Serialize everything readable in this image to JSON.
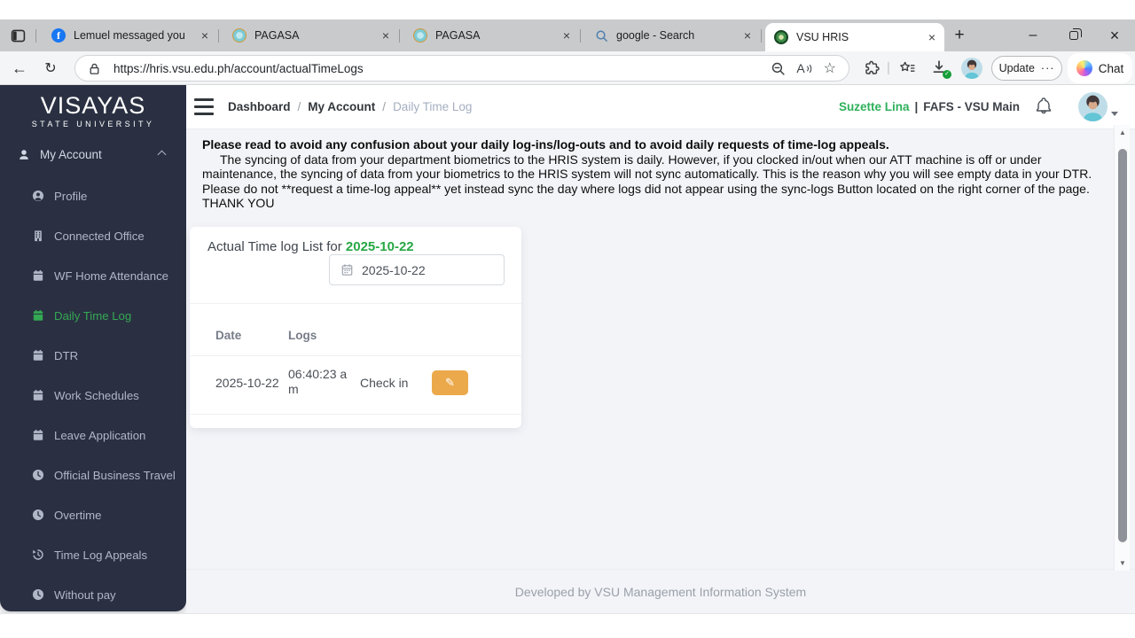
{
  "browser": {
    "tabs": [
      {
        "title": "Lemuel messaged you",
        "icon": "facebook"
      },
      {
        "title": "PAGASA",
        "icon": "pagasa"
      },
      {
        "title": "PAGASA",
        "icon": "pagasa"
      },
      {
        "title": "google - Search",
        "icon": "search"
      },
      {
        "title": "VSU HRIS",
        "icon": "vsu-seal",
        "active": true
      }
    ],
    "url": "https://hris.vsu.edu.ph/account/actualTimeLogs",
    "update_label": "Update",
    "chat_label": "Chat"
  },
  "glyphs": {
    "fb": "f",
    "tab_close": "×",
    "new_tab": "+",
    "minimize": "–",
    "window_close": "×",
    "back": "←",
    "refresh": "↻",
    "star": "☆",
    "read_aloud": "A",
    "dots": "···",
    "pipe": "|",
    "pencil": "✎",
    "scroll_up": "▲",
    "scroll_down": "▼",
    "breadcrumb_sep": "/",
    "user_sep": "|"
  },
  "sidebar": {
    "logo_line1": "VISAYAS",
    "logo_line2": "STATE UNIVERSITY",
    "parent": "My Account",
    "items": [
      {
        "label": "Profile",
        "icon": "user-circle"
      },
      {
        "label": "Connected Office",
        "icon": "building"
      },
      {
        "label": "WF Home Attendance",
        "icon": "calendar"
      },
      {
        "label": "Daily Time Log",
        "icon": "calendar",
        "active": true
      },
      {
        "label": "DTR",
        "icon": "calendar"
      },
      {
        "label": "Work Schedules",
        "icon": "calendar"
      },
      {
        "label": "Leave Application",
        "icon": "calendar"
      },
      {
        "label": "Official Business Travel",
        "icon": "clock"
      },
      {
        "label": "Overtime",
        "icon": "clock"
      },
      {
        "label": "Time Log Appeals",
        "icon": "history"
      },
      {
        "label": "Without pay",
        "icon": "clock"
      }
    ]
  },
  "header": {
    "breadcrumb": [
      "Dashboard",
      "My Account",
      "Daily Time Log"
    ],
    "user_name": "Suzette Lina",
    "user_unit": "FAFS - VSU Main"
  },
  "notice": {
    "heading": "Please read to avoid any confusion about your daily log-ins/log-outs and to avoid daily requests of time-log appeals.",
    "body": "The syncing of data from your department biometrics to the HRIS system is daily. However, if you clocked in/out when our ATT machine is off or under maintenance, the syncing of data from your biometrics to the HRIS system will not sync automatically. This is the reason why you will see empty data in your DTR. Please do not **request a time-log appeal** yet instead sync the day where logs did not appear using the sync-logs Button located on the right corner of the page. THANK YOU"
  },
  "card": {
    "title_prefix": "Actual Time log List for ",
    "title_date": "2025-10-22",
    "date_value": "2025-10-22",
    "columns": [
      "Date",
      "Logs"
    ],
    "rows": [
      {
        "date": "2025-10-22",
        "time": "06:40:23 am",
        "type": "Check in"
      }
    ]
  },
  "footer": {
    "text": "Developed by VSU Management Information System"
  },
  "colors": {
    "sidebar_bg": "#2a3042",
    "accent_green": "#34a853",
    "title_green": "#28a745",
    "warning_orange": "#eca94b"
  }
}
